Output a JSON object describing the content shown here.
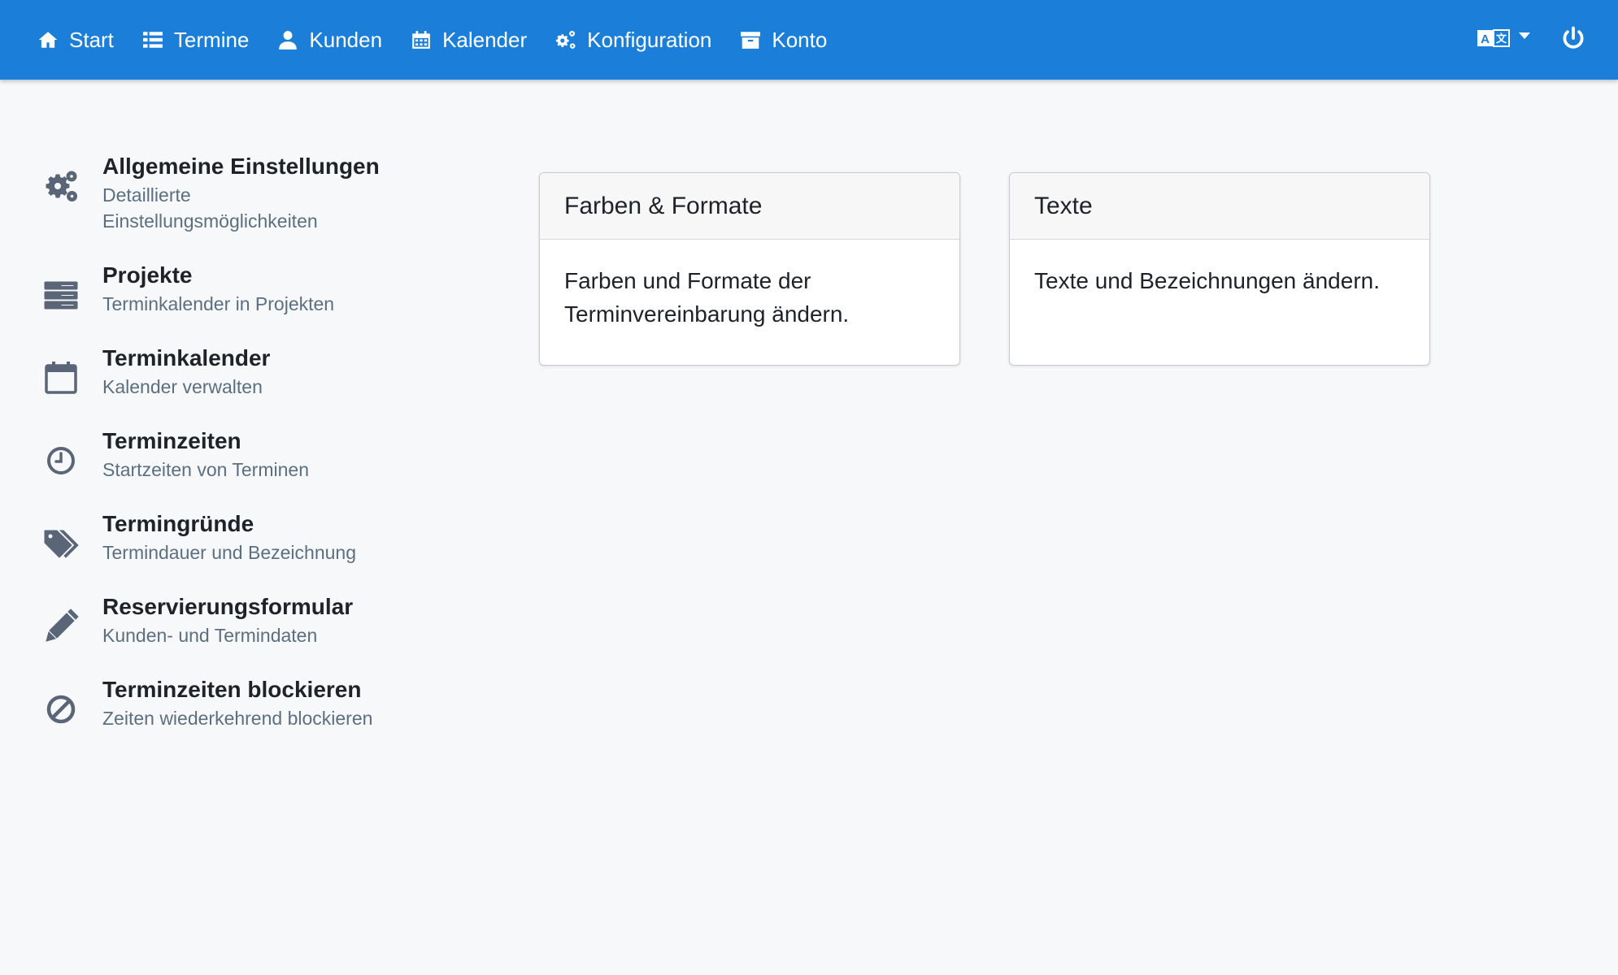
{
  "nav": {
    "items": [
      {
        "label": "Start",
        "icon": "home-icon"
      },
      {
        "label": "Termine",
        "icon": "list-icon"
      },
      {
        "label": "Kunden",
        "icon": "user-icon"
      },
      {
        "label": "Kalender",
        "icon": "calendar-icon"
      },
      {
        "label": "Konfiguration",
        "icon": "cogs-icon"
      },
      {
        "label": "Konto",
        "icon": "archive-icon"
      }
    ],
    "language_icon": "translate-icon",
    "power_icon": "power-icon",
    "background": "#1b7fd9"
  },
  "menu": {
    "items": [
      {
        "title": "Allgemeine Einstellungen",
        "subtitle": "Detaillierte Einstellungsmöglichkeiten",
        "icon": "cogs-icon"
      },
      {
        "title": "Projekte",
        "subtitle": "Terminkalender in Projekten",
        "icon": "server-icon"
      },
      {
        "title": "Terminkalender",
        "subtitle": "Kalender verwalten",
        "icon": "calendar-icon"
      },
      {
        "title": "Terminzeiten",
        "subtitle": "Startzeiten von Terminen",
        "icon": "clock-icon"
      },
      {
        "title": "Termingründe",
        "subtitle": "Termindauer und Bezeichnung",
        "icon": "tags-icon"
      },
      {
        "title": "Reservierungsformular",
        "subtitle": "Kunden- und Termindaten",
        "icon": "pencil-icon"
      },
      {
        "title": "Terminzeiten blockieren",
        "subtitle": "Zeiten wiederkehrend blockieren",
        "icon": "ban-icon"
      }
    ]
  },
  "cards": [
    {
      "title": "Farben & Formate",
      "body": "Farben und Formate der Terminvereinbarung ändern."
    },
    {
      "title": "Texte",
      "body": "Texte und Bezeichnungen ändern."
    }
  ]
}
